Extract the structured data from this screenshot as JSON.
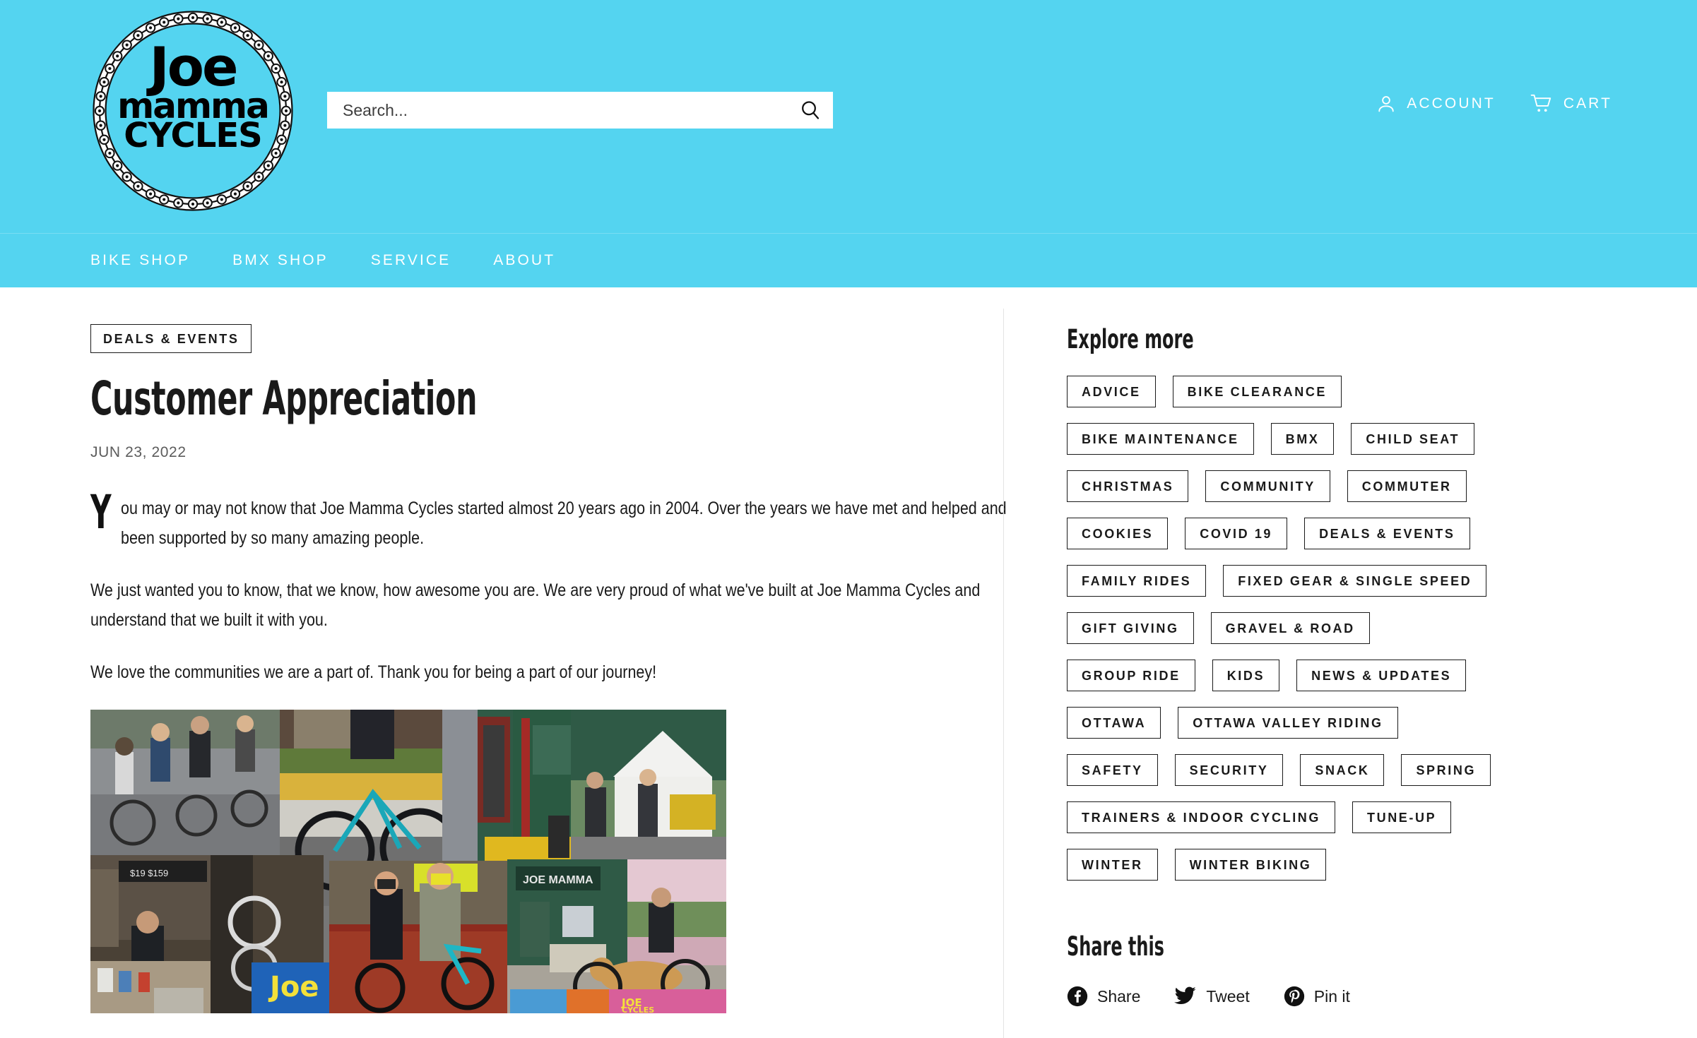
{
  "brand": {
    "logo_line1": "Joe",
    "logo_line2": "mamma",
    "logo_line3": "CYCLES",
    "header_bg": "#54D4F0"
  },
  "search": {
    "placeholder": "Search...",
    "value": "",
    "icon": "search-icon"
  },
  "header": {
    "account_label": "ACCOUNT",
    "account_icon": "user-icon",
    "cart_label": "CART",
    "cart_icon": "shopping-cart-icon"
  },
  "nav": {
    "items": [
      {
        "label": "BIKE SHOP"
      },
      {
        "label": "BMX SHOP"
      },
      {
        "label": "SERVICE"
      },
      {
        "label": "ABOUT"
      }
    ]
  },
  "article": {
    "category_badge": "DEALS & EVENTS",
    "title": "Customer Appreciation",
    "date": "JUN 23, 2022",
    "dropcap": "Y",
    "paragraph_1": "ou may or may not know that Joe Mamma Cycles started almost 20 years ago in 2004. Over the years we have met and helped and been supported by so many amazing people.",
    "paragraph_2": "We just wanted you to know, that we know, how awesome you are. We are very proud of what we've built at Joe Mamma Cycles and understand that we built it with you.",
    "paragraph_3": "We love the communities we are a part of. Thank you for being a part of our journey!",
    "image_alt": "photo-collage-of-joe-mamma-cycles-customers-and-shop"
  },
  "sidebar": {
    "explore_heading": "Explore more",
    "tags": [
      "ADVICE",
      "BIKE CLEARANCE",
      "BIKE MAINTENANCE",
      "BMX",
      "CHILD SEAT",
      "CHRISTMAS",
      "COMMUNITY",
      "COMMUTER",
      "COOKIES",
      "COVID 19",
      "DEALS & EVENTS",
      "FAMILY RIDES",
      "FIXED GEAR & SINGLE SPEED",
      "GIFT GIVING",
      "GRAVEL & ROAD",
      "GROUP RIDE",
      "KIDS",
      "NEWS & UPDATES",
      "OTTAWA",
      "OTTAWA VALLEY RIDING",
      "SAFETY",
      "SECURITY",
      "SNACK",
      "SPRING",
      "TRAINERS & INDOOR CYCLING",
      "TUNE-UP",
      "WINTER",
      "WINTER BIKING"
    ],
    "share_heading": "Share this",
    "share_links": [
      {
        "label": "Share",
        "icon": "facebook-icon"
      },
      {
        "label": "Tweet",
        "icon": "twitter-icon"
      },
      {
        "label": "Pin it",
        "icon": "pinterest-icon"
      }
    ]
  }
}
